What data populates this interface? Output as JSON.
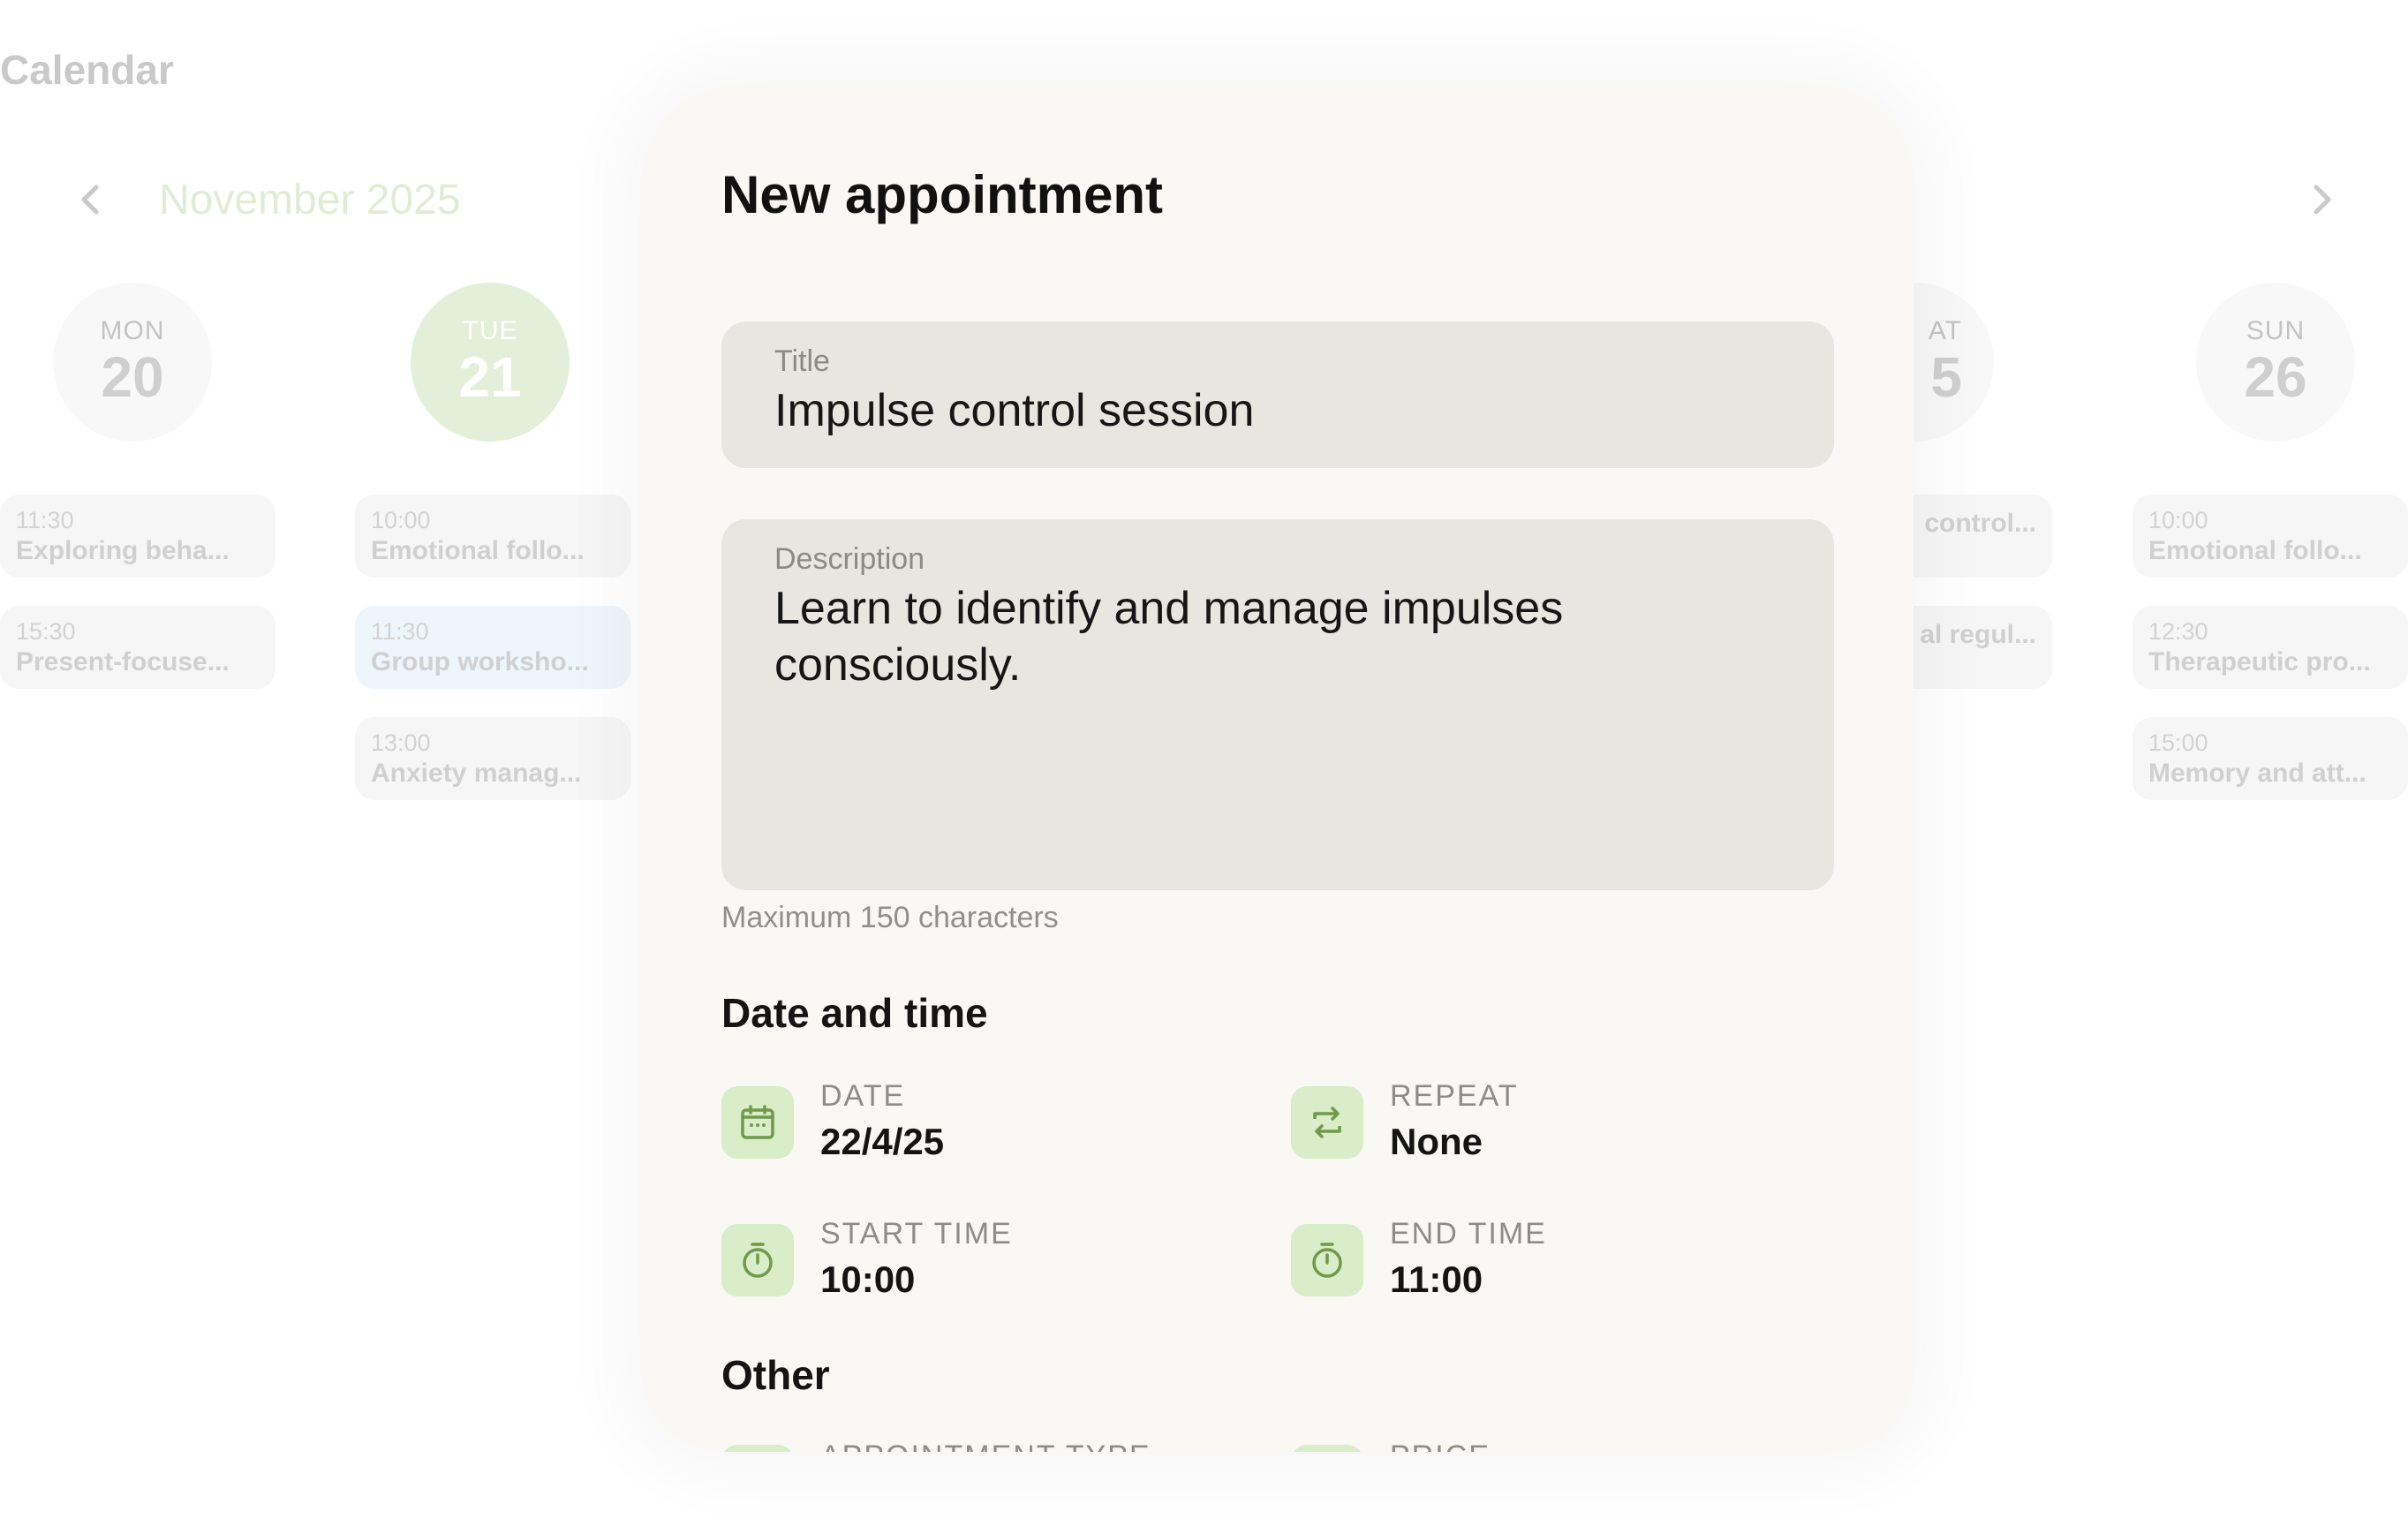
{
  "calendar": {
    "title": "Calendar",
    "month": "November 2025",
    "days": [
      {
        "dow": "MON",
        "num": "20",
        "active": false
      },
      {
        "dow": "TUE",
        "num": "21",
        "active": true
      },
      {
        "dow": "AT",
        "num": "5",
        "active": false
      },
      {
        "dow": "SUN",
        "num": "26",
        "active": false
      }
    ],
    "events": {
      "mon": [
        {
          "time": "11:30",
          "name": "Exploring beha..."
        },
        {
          "time": "15:30",
          "name": "Present-focuse..."
        }
      ],
      "tue": [
        {
          "time": "10:00",
          "name": "Emotional follo..."
        },
        {
          "time": "11:30",
          "name": "Group worksho..."
        },
        {
          "time": "13:00",
          "name": "Anxiety manag..."
        }
      ],
      "sat": [
        {
          "time": "",
          "name": "control..."
        },
        {
          "time": "",
          "name": "al regul..."
        }
      ],
      "sun": [
        {
          "time": "10:00",
          "name": "Emotional follo..."
        },
        {
          "time": "12:30",
          "name": "Therapeutic pro..."
        },
        {
          "time": "15:00",
          "name": "Memory and att..."
        }
      ]
    }
  },
  "modal": {
    "title": "New appointment",
    "title_field": {
      "label": "Title",
      "value": "Impulse control session"
    },
    "description_field": {
      "label": "Description",
      "value": "Learn to identify and manage impulses consciously."
    },
    "helper": "Maximum 150 characters",
    "date_time": {
      "heading": "Date and time",
      "date": {
        "label": "DATE",
        "value": "22/4/25",
        "icon": "calendar-icon"
      },
      "repeat": {
        "label": "REPEAT",
        "value": "None",
        "icon": "repeat-icon"
      },
      "start": {
        "label": "START TIME",
        "value": "10:00",
        "icon": "timer-icon"
      },
      "end": {
        "label": "END TIME",
        "value": "11:00",
        "icon": "timer-icon"
      }
    },
    "other": {
      "heading": "Other",
      "appointment_type": {
        "label": "APPOINTMENT TYPE"
      },
      "price": {
        "label": "PRICE"
      }
    }
  },
  "colors": {
    "accent": "#d9edc8",
    "icon_green": "#6f9a4a",
    "modal_bg": "#f9f8f4",
    "field_bg": "#e7e6e1"
  }
}
